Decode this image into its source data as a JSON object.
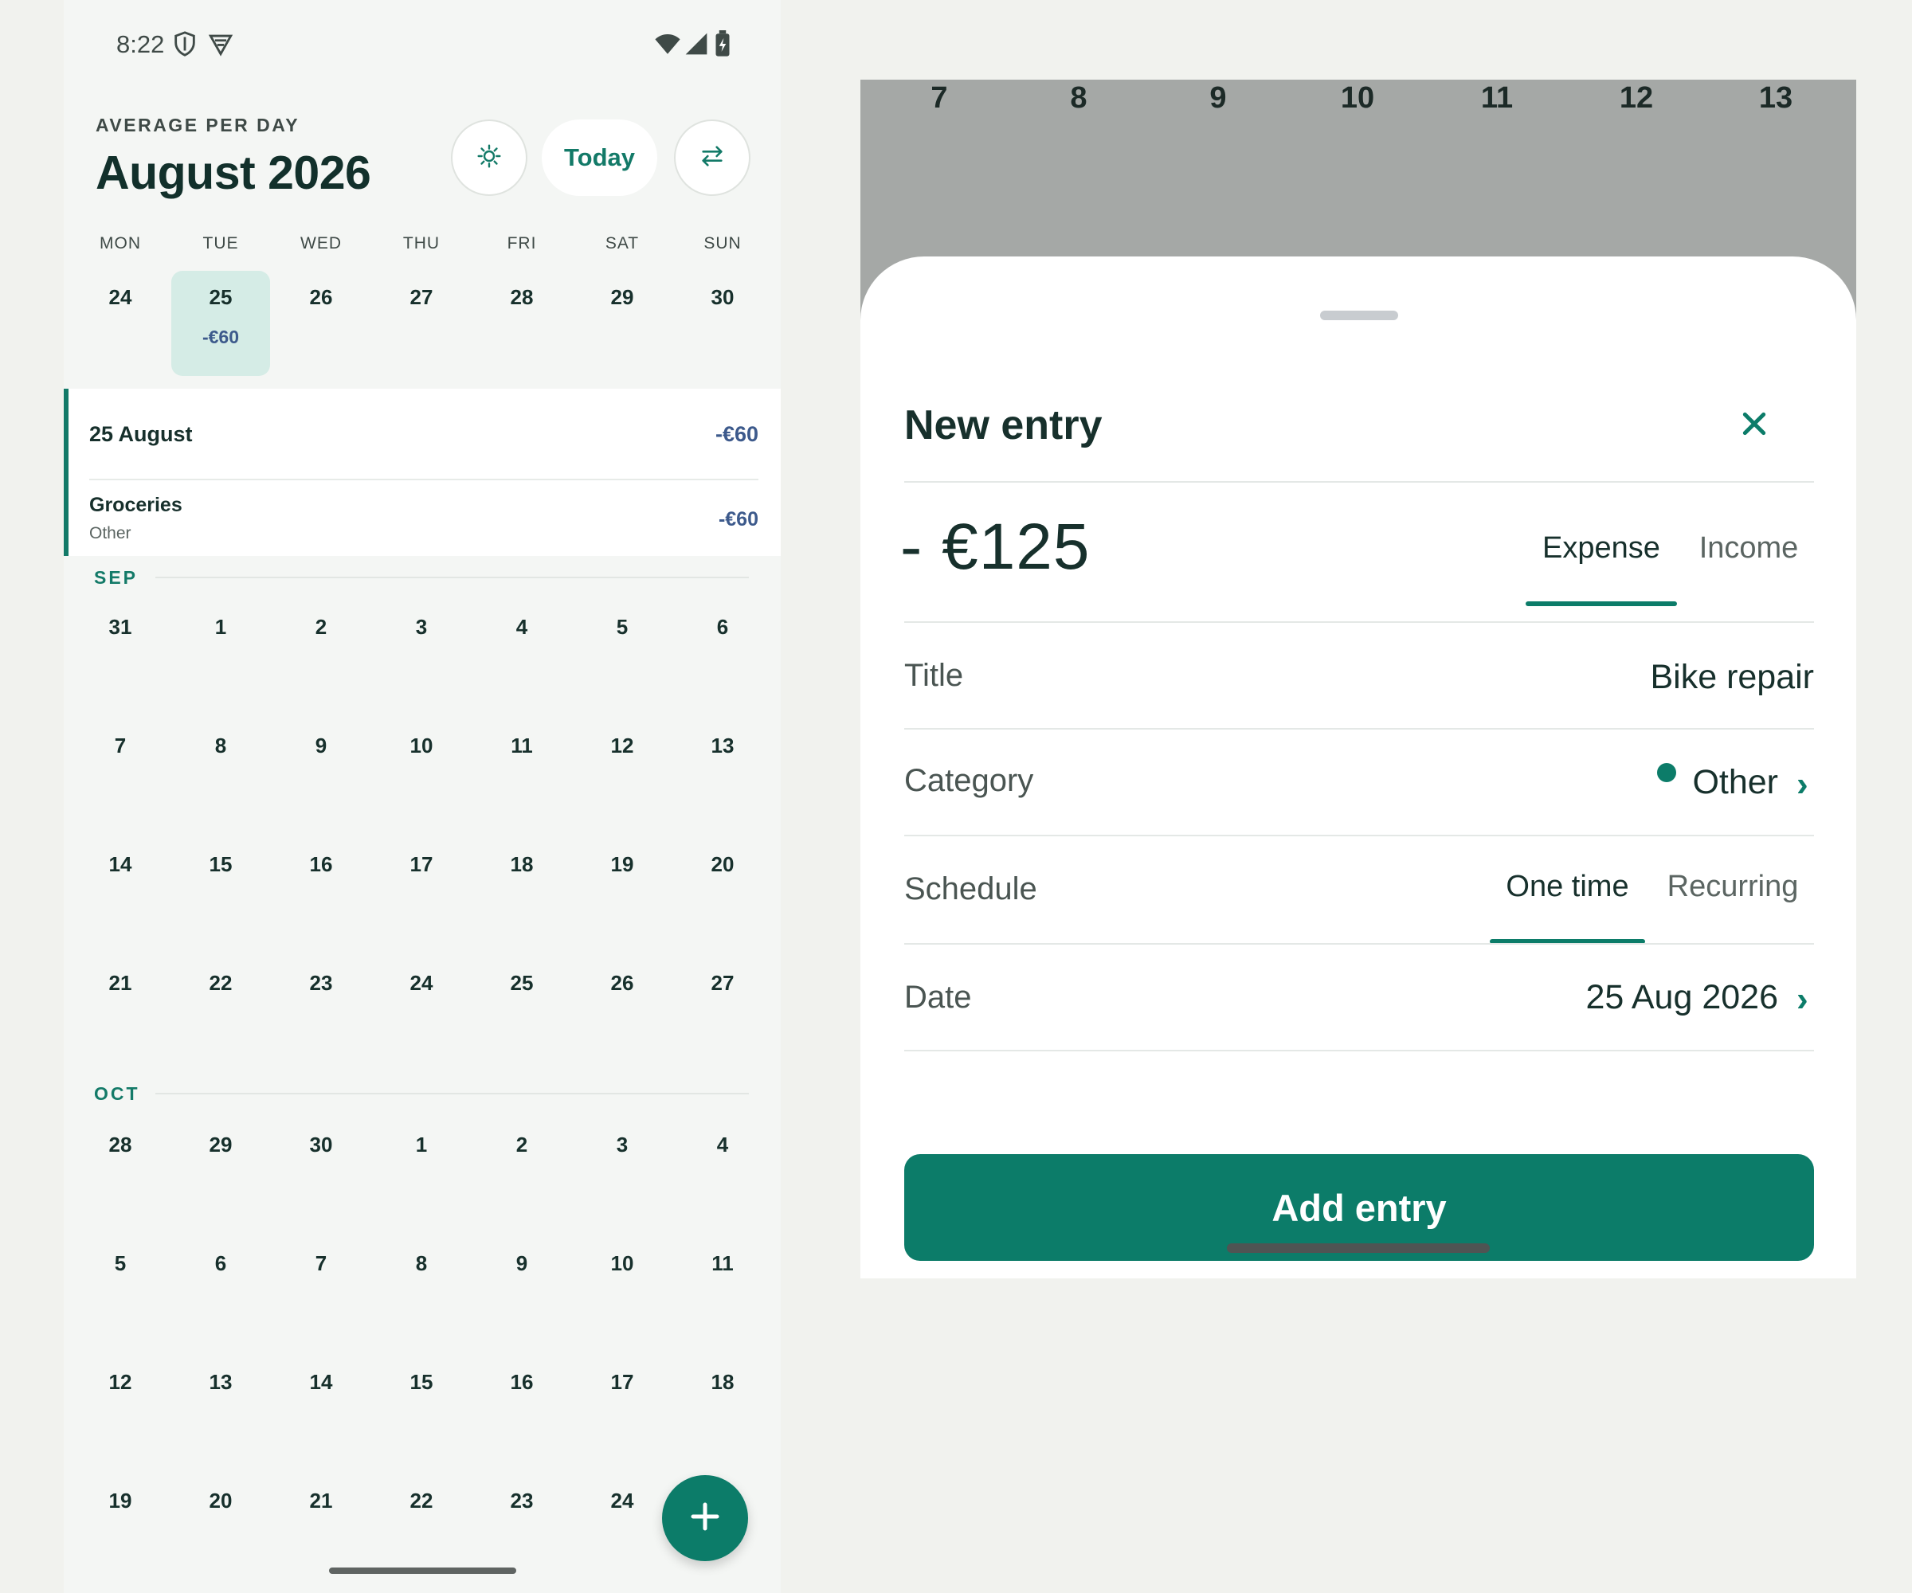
{
  "status_bar": {
    "time": "8:22",
    "icons": [
      "shield-icon",
      "vpn-icon",
      "wifi-icon",
      "signal-icon",
      "battery-charging-icon"
    ]
  },
  "header": {
    "overline": "AVERAGE PER DAY",
    "title": "August 2026",
    "theme_button_icon": "sun-icon",
    "today_label": "Today",
    "swap_button_icon": "swap-icon"
  },
  "weekdays": [
    "MON",
    "TUE",
    "WED",
    "THU",
    "FRI",
    "SAT",
    "SUN"
  ],
  "current_week": {
    "days": [
      "24",
      "25",
      "26",
      "27",
      "28",
      "29",
      "30"
    ],
    "selected_day": "25",
    "selected_amount": "-€60"
  },
  "day_detail": {
    "date_label": "25 August",
    "total": "-€60",
    "entries": [
      {
        "title": "Groceries",
        "category": "Other",
        "amount": "-€60"
      }
    ]
  },
  "months": [
    {
      "label": "SEP",
      "weeks": [
        [
          "31",
          "1",
          "2",
          "3",
          "4",
          "5",
          "6"
        ],
        [
          "7",
          "8",
          "9",
          "10",
          "11",
          "12",
          "13"
        ],
        [
          "14",
          "15",
          "16",
          "17",
          "18",
          "19",
          "20"
        ],
        [
          "21",
          "22",
          "23",
          "24",
          "25",
          "26",
          "27"
        ]
      ]
    },
    {
      "label": "OCT",
      "weeks": [
        [
          "28",
          "29",
          "30",
          "1",
          "2",
          "3",
          "4"
        ],
        [
          "5",
          "6",
          "7",
          "8",
          "9",
          "10",
          "11"
        ],
        [
          "12",
          "13",
          "14",
          "15",
          "16",
          "17",
          "18"
        ],
        [
          "19",
          "20",
          "21",
          "22",
          "23",
          "24",
          ""
        ]
      ]
    }
  ],
  "fab": {
    "icon": "plus-icon"
  },
  "background_week": [
    "7",
    "8",
    "9",
    "10",
    "11",
    "12",
    "13"
  ],
  "new_entry_sheet": {
    "title": "New entry",
    "close_icon": "close-icon",
    "amount": "- €125",
    "type_options": [
      "Expense",
      "Income"
    ],
    "type_selected": "Expense",
    "fields": {
      "title_label": "Title",
      "title_value": "Bike repair",
      "category_label": "Category",
      "category_value": "Other",
      "schedule_label": "Schedule",
      "schedule_options": [
        "One time",
        "Recurring"
      ],
      "schedule_selected": "One time",
      "date_label": "Date",
      "date_value": "25 Aug 2026"
    },
    "submit_label": "Add entry"
  },
  "colors": {
    "accent": "#0c7c69",
    "expense_text": "#3d5a8c",
    "selected_day_bg": "#d5ece6",
    "scrim": "#a5a8a6"
  }
}
